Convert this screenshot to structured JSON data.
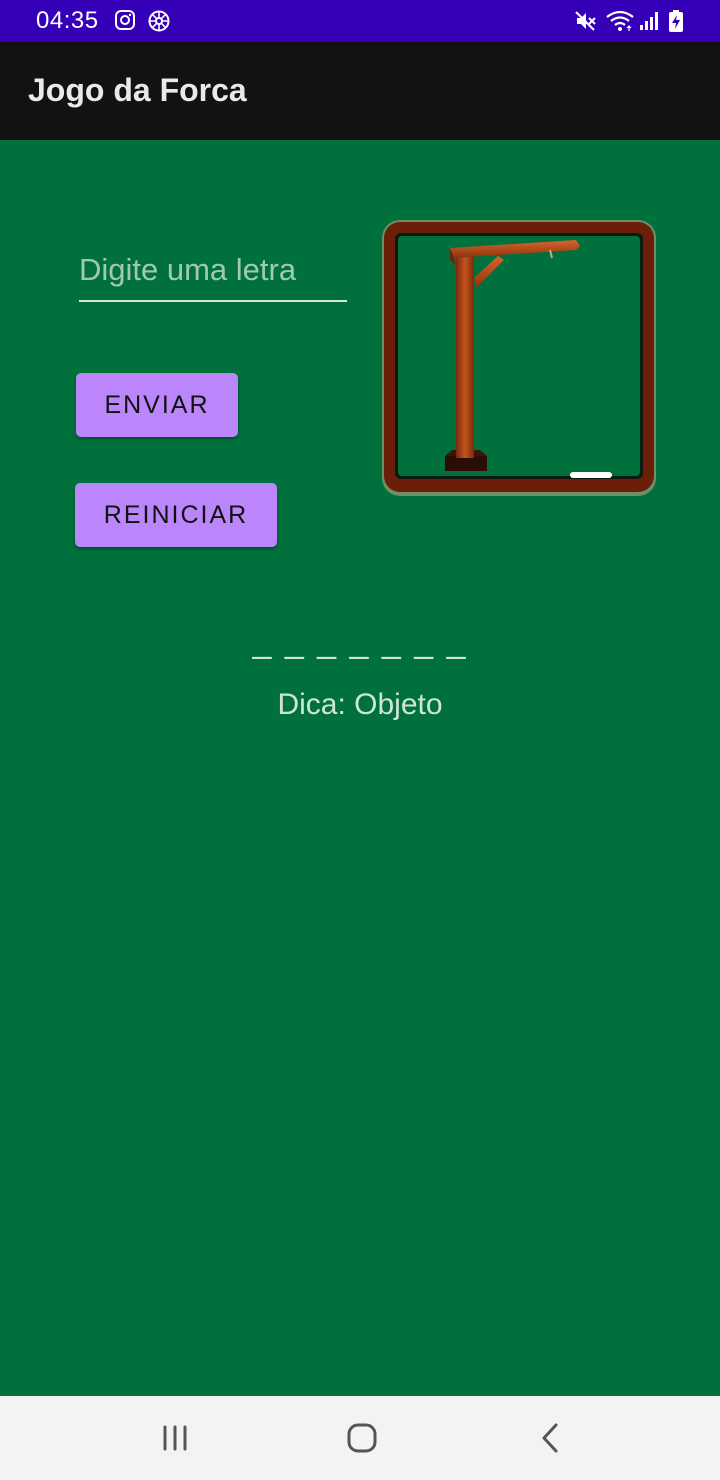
{
  "status_bar": {
    "time": "04:35",
    "background": "#3500b8",
    "left_icons": [
      "instagram-icon",
      "settings-wheel-icon"
    ],
    "right_icons": [
      "mute-icon",
      "wifi-icon",
      "signal-icon",
      "battery-charging-icon"
    ]
  },
  "app_bar": {
    "title": "Jogo da Forca"
  },
  "game": {
    "input_placeholder": "Digite uma letra",
    "input_value": "",
    "send_label": "ENVIAR",
    "restart_label": "REINICIAR",
    "word_display": "_ _ _ _ _ _ _",
    "hint": "Dica: Objeto",
    "background": "#00713c",
    "button_color": "#bb86fc"
  },
  "nav_bar": {
    "buttons": [
      "recent-apps-icon",
      "home-icon",
      "back-icon"
    ]
  }
}
